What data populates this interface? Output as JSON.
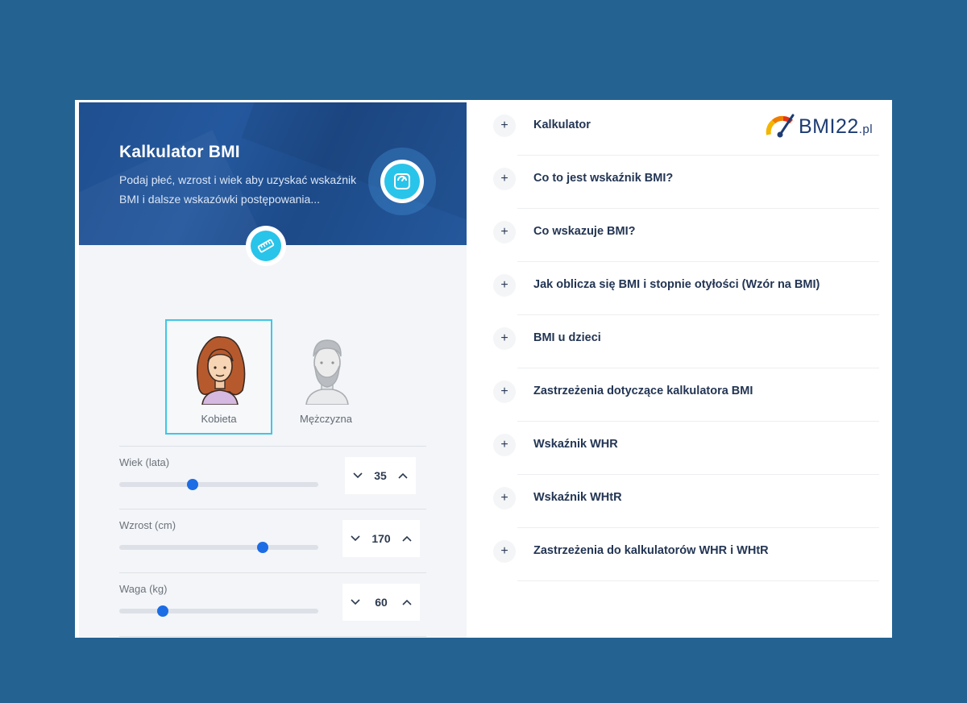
{
  "calculator": {
    "title": "Kalkulator BMI",
    "description": "Podaj płeć, wzrost i wiek aby uzyskać wskaźnik BMI i dalsze wskazówki postępowania...",
    "header_icon": "bathroom-scale-icon",
    "tab_icon": "ruler-icon"
  },
  "gender": {
    "options": [
      {
        "label": "Kobieta",
        "icon": "woman-avatar-icon",
        "selected": true
      },
      {
        "label": "Mężczyzna",
        "icon": "man-avatar-icon",
        "selected": false
      }
    ]
  },
  "sliders": [
    {
      "label": "Wiek (lata)",
      "value": "35",
      "fraction": 0.37
    },
    {
      "label": "Wzrost (cm)",
      "value": "170",
      "fraction": 0.72
    },
    {
      "label": "Waga (kg)",
      "value": "60",
      "fraction": 0.22
    }
  ],
  "logo": {
    "text": "BMI22",
    "suffix": ".pl"
  },
  "accordion": [
    {
      "label": "Kalkulator"
    },
    {
      "label": "Co to jest wskaźnik BMI?"
    },
    {
      "label": "Co wskazuje BMI?"
    },
    {
      "label": "Jak oblicza się BMI i stopnie otyłości (Wzór na BMI)"
    },
    {
      "label": "BMI u dzieci"
    },
    {
      "label": "Zastrzeżenia dotyczące kalkulatora BMI"
    },
    {
      "label": "Wskaźnik WHR"
    },
    {
      "label": "Wskaźnik WHtR"
    },
    {
      "label": "Zastrzeżenia do kalkulatorów WHR i WHtR"
    }
  ],
  "plus_symbol": "+",
  "colors": {
    "background": "#246292",
    "accent": "#29c4ea",
    "slider_knob": "#1c6ce5",
    "heading": "#233553"
  }
}
